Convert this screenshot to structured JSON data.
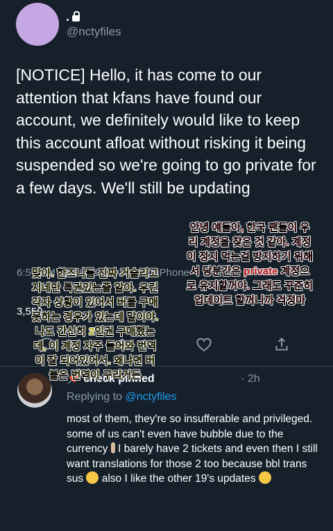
{
  "tweet": {
    "display_name": ".",
    "handle": "@nctyfiles",
    "text": "[NOTICE] Hello, it has come to our attention that kfans have found our account, we definitely would like to keep this account afloat without risking it being suspended so we're going to go private for a few days. We'll still be updating",
    "meta": "6:5_ PM · 12/8/21 · Twitter for iPhone",
    "retweet_count": "3,550"
  },
  "overlay": {
    "korean_red_lines": [
      "안녕 얘들아, 한국 팬들이 우",
      "리 계정을 찾은 것 같아. 계정",
      "이 정지 먹는걸 방지하기 위해",
      "서 당분간은 private 계정으",
      "로 유지할꺼야. 그래도 꾸준히",
      "업데이트 할꺼니까 걱정마"
    ],
    "korean_yellow_lines": [
      "맞아. 한즈니들 진짜 거슬리고",
      "지네만 특권있는줄 알아. 우린",
      "각자 상황이 있어서 버블 구매",
      "못하는 경우가 있는데 말이야.",
      "나도 간신히 2인권 구매했는",
      "데, 이 계정 자주 들어와 번역",
      "이 잘 되어있어서. 왜냐면 버",
      "블은 번역이 구리거든"
    ]
  },
  "reply": {
    "header": "check pinned",
    "time": "· 2h",
    "replying_prefix": "Replying to",
    "replying_handle": "@nctyfiles",
    "line1": "most of them, they're so insufferable and privileged. some of us can't even have bubble due to the currency",
    "line2": " I barely have 2 tickets and even then I still want translations for those 2 too because bbl trans sus",
    "line3": " also I like the other 19's updates"
  },
  "icons": [
    "lock-icon",
    "reply-icon",
    "retweet-icon",
    "like-icon",
    "share-icon",
    "pin-icon",
    "person-emoji",
    "pensive-emoji",
    "grin-emoji"
  ],
  "colors": {
    "background": "#15202b",
    "text": "#e7e9ea",
    "muted": "#8b98a5",
    "link": "#1d9bf0",
    "overlay_red": "#e8262b",
    "overlay_yellow": "#e9de1c"
  }
}
